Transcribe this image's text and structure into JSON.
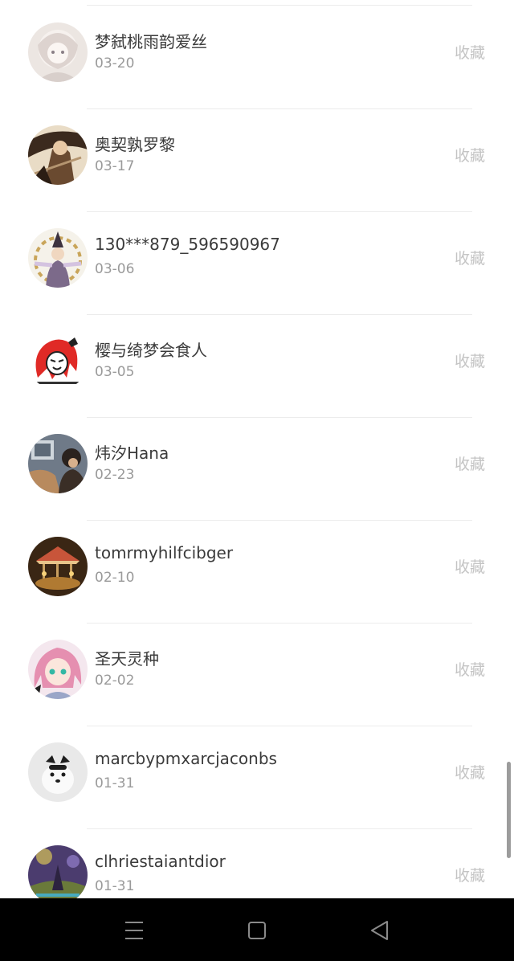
{
  "favorite_label": "收藏",
  "contacts": [
    {
      "name": "梦弑桃雨韵爱丝",
      "date": "03-20",
      "avatar_icon": "anime-girl-light-avatar-icon"
    },
    {
      "name": "奥契孰罗黎",
      "date": "03-17",
      "avatar_icon": "warrior-avatar-icon"
    },
    {
      "name": "130***879_596590967",
      "date": "03-06",
      "avatar_icon": "fantasy-character-avatar-icon"
    },
    {
      "name": "樱与绮梦会食人",
      "date": "03-05",
      "avatar_icon": "red-hair-cartoon-avatar-icon"
    },
    {
      "name": "炜汐Hana",
      "date": "02-23",
      "avatar_icon": "photo-avatar-icon"
    },
    {
      "name": "tomrmyhilfcibger",
      "date": "02-10",
      "avatar_icon": "carousel-avatar-icon"
    },
    {
      "name": "圣天灵种",
      "date": "02-02",
      "avatar_icon": "pink-hair-anime-avatar-icon"
    },
    {
      "name": "marcbypmxarcjaconbs",
      "date": "01-31",
      "avatar_icon": "white-dog-avatar-icon"
    },
    {
      "name": "clhriestaiantdior",
      "date": "01-31",
      "avatar_icon": "night-scene-avatar-icon"
    }
  ],
  "nav": {
    "menu_icon": "menu-icon",
    "home_icon": "home-square-icon",
    "back_icon": "back-triangle-icon"
  },
  "colors": {
    "name_text": "#3b3b3b",
    "date_text": "#9a9a9a",
    "favorite_text": "#c4c4c4",
    "divider": "#ececec",
    "navbar_bg": "#000000"
  }
}
